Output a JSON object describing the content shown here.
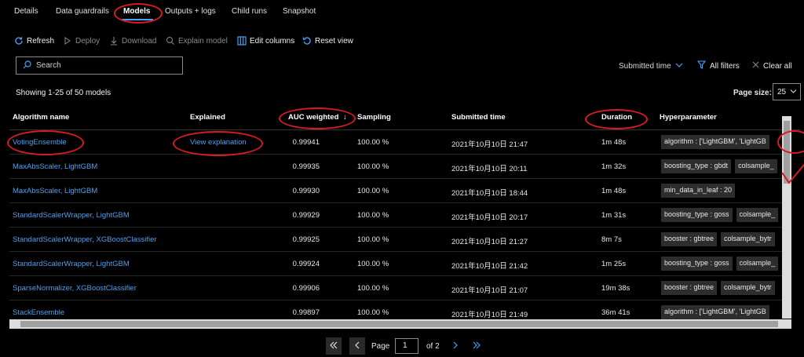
{
  "tabs": [
    "Details",
    "Data guardrails",
    "Models",
    "Outputs + logs",
    "Child runs",
    "Snapshot"
  ],
  "toolbar": {
    "refresh": "Refresh",
    "deploy": "Deploy",
    "download": "Download",
    "explain": "Explain model",
    "edit_columns": "Edit columns",
    "reset_view": "Reset view"
  },
  "search": {
    "placeholder": "Search"
  },
  "filters": {
    "sort": "Submitted time",
    "all_filters": "All filters",
    "clear_all": "Clear all"
  },
  "showing": "Showing 1-25 of 50 models",
  "page_size": {
    "label": "Page size:",
    "value": "25"
  },
  "columns": {
    "algorithm": "Algorithm name",
    "explained": "Explained",
    "auc": "AUC weighted",
    "sampling": "Sampling",
    "submitted": "Submitted time",
    "duration": "Duration",
    "hyperparameter": "Hyperparameter"
  },
  "rows": [
    {
      "algorithm": "VotingEnsemble",
      "explained": "View explanation",
      "auc": "0.99941",
      "sampling": "100.00 %",
      "submitted": "2021年10月10日 21:47",
      "duration": "1m 48s",
      "chips": [
        "algorithm : ['LightGBM', 'LightGB"
      ]
    },
    {
      "algorithm": "MaxAbsScaler, LightGBM",
      "explained": "",
      "auc": "0.99935",
      "sampling": "100.00 %",
      "submitted": "2021年10月10日 20:11",
      "duration": "1m 32s",
      "chips": [
        "boosting_type : gbdt",
        "colsample_"
      ]
    },
    {
      "algorithm": "MaxAbsScaler, LightGBM",
      "explained": "",
      "auc": "0.99930",
      "sampling": "100.00 %",
      "submitted": "2021年10月10日 18:44",
      "duration": "1m 48s",
      "chips": [
        "min_data_in_leaf : 20"
      ]
    },
    {
      "algorithm": "StandardScalerWrapper, LightGBM",
      "explained": "",
      "auc": "0.99929",
      "sampling": "100.00 %",
      "submitted": "2021年10月10日 20:17",
      "duration": "1m 31s",
      "chips": [
        "boosting_type : goss",
        "colsample_"
      ]
    },
    {
      "algorithm": "StandardScalerWrapper, XGBoostClassifier",
      "explained": "",
      "auc": "0.99925",
      "sampling": "100.00 %",
      "submitted": "2021年10月10日 21:27",
      "duration": "8m 7s",
      "chips": [
        "booster : gbtree",
        "colsample_bytr"
      ]
    },
    {
      "algorithm": "StandardScalerWrapper, LightGBM",
      "explained": "",
      "auc": "0.99924",
      "sampling": "100.00 %",
      "submitted": "2021年10月10日 21:42",
      "duration": "1m 25s",
      "chips": [
        "boosting_type : goss",
        "colsample_"
      ]
    },
    {
      "algorithm": "SparseNormalizer, XGBoostClassifier",
      "explained": "",
      "auc": "0.99906",
      "sampling": "100.00 %",
      "submitted": "2021年10月10日 21:07",
      "duration": "19m 38s",
      "chips": [
        "booster : gbtree",
        "colsample_bytr"
      ]
    },
    {
      "algorithm": "StackEnsemble",
      "explained": "",
      "auc": "0.99897",
      "sampling": "100.00 %",
      "submitted": "2021年10月10日 21:49",
      "duration": "36m 41s",
      "chips": [
        "algorithm : ['LightGBM', 'LightGB"
      ]
    }
  ],
  "pager": {
    "label": "Page",
    "current": "1",
    "of": "of 2"
  },
  "colors": {
    "accent": "#4aa0f5",
    "annotation": "#d51b25"
  }
}
